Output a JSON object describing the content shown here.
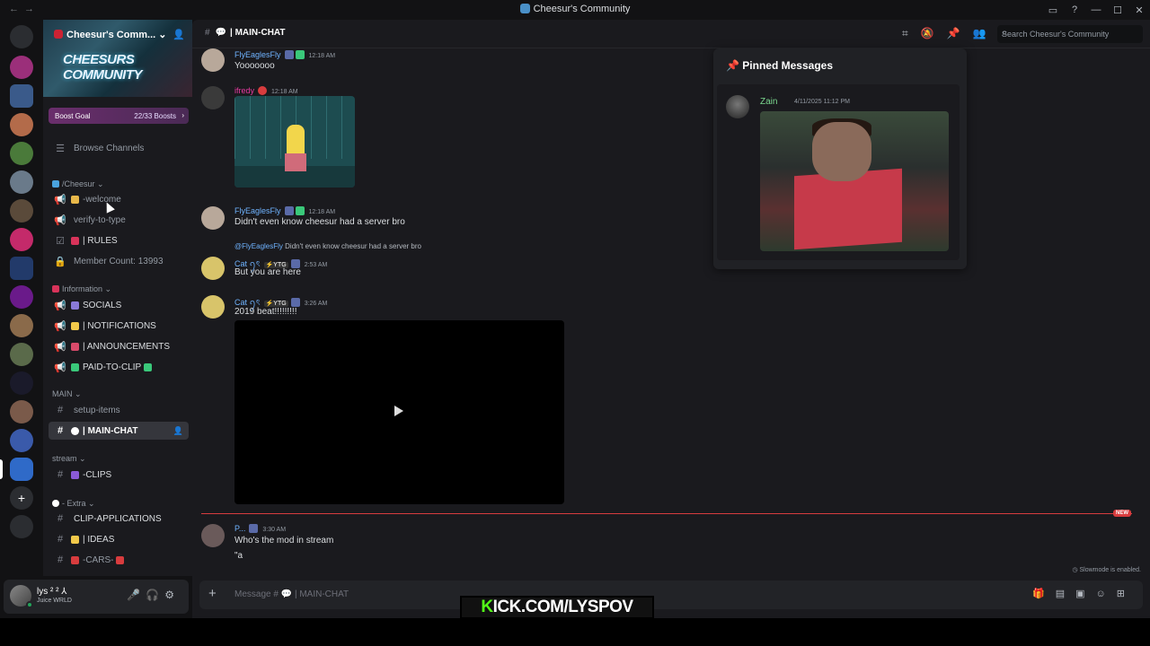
{
  "window": {
    "title": "Cheesur's Community",
    "controls": [
      "▭",
      "?",
      "—",
      "☐",
      "✕"
    ]
  },
  "server": {
    "name": "Cheesur's Comm...",
    "banner_text": "CHEESURS COMMUNITY"
  },
  "boost": {
    "label": "Boost Goal",
    "progress": "22/33 Boosts"
  },
  "sidebar": {
    "browse": "Browse Channels",
    "categories": {
      "cheesur": "/Cheesur",
      "information": "Information",
      "main": "MAIN",
      "stream": "stream",
      "extra": "- Extra"
    },
    "channels": {
      "welcome": "-welcome",
      "verify": "verify-to-type",
      "rules": "| RULES",
      "member_count": "Member Count: 13993",
      "socials": "SOCIALS",
      "notifications": "| NOTIFICATIONS",
      "announcements": "| ANNOUNCEMENTS",
      "paid_to_clip": "PAID-TO-CLIP",
      "setup_items": "setup-items",
      "main_chat": "| MAIN-CHAT",
      "clips": "-CLIPS",
      "clip_applications": "CLIP-APPLICATIONS",
      "ideas": "| IDEAS",
      "cars": "-CARS-"
    }
  },
  "user": {
    "name": "lys ² ² ⅄",
    "status": "Juice WRLD"
  },
  "header": {
    "channel": "| MAIN-CHAT",
    "search_placeholder": "Search Cheesur's Community"
  },
  "messages": [
    {
      "author": "FlyEaglesFly",
      "time": "12:18 AM",
      "text": "Yooooooo"
    },
    {
      "author": "ifredy",
      "time": "12:18 AM",
      "text": ""
    },
    {
      "author": "FlyEaglesFly",
      "time": "12:18 AM",
      "text": "Didn't even know cheesur had a server bro"
    },
    {
      "reply_to": "@FlyEaglesFly",
      "reply_text": "Didn't even know cheesur had a server bro",
      "author": "Cat ꪆৎ",
      "tag": "⚡YTG",
      "time": "2:53 AM",
      "text": "But you are here"
    },
    {
      "author": "Cat ꪆৎ",
      "tag": "⚡YTG",
      "time": "3:26 AM",
      "text": "2019 beat!!!!!!!!!"
    },
    {
      "author": "P...",
      "time": "3:30 AM",
      "text": "Who's the mod in stream",
      "text2": "\"a"
    }
  ],
  "new_label": "NEW",
  "slowmode": "Slowmode is enabled.",
  "composer": {
    "placeholder": "Message #",
    "channel": "| MAIN-CHAT"
  },
  "pinned": {
    "title": "Pinned Messages",
    "author": "Zain",
    "time": "4/11/2025 11:12 PM"
  },
  "overlay": {
    "prefix": "K",
    "text": "ICK.COM/LYSPOV"
  },
  "colors": {
    "accent": "#5865f2",
    "online": "#23a55a",
    "new": "#d83c3e",
    "kick": "#53fc18",
    "link": "#6fb3ff"
  }
}
